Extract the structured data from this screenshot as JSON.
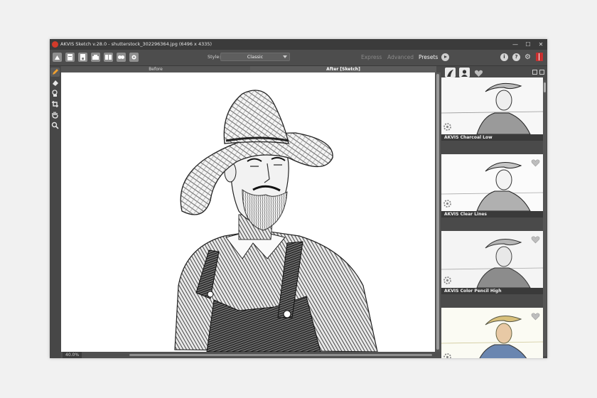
{
  "window": {
    "title": "AKVIS Sketch v.28.0 - shutterstock_302296364.jpg (6496 x 4335)",
    "controls": {
      "minimize": "—",
      "maximize": "☐",
      "close": "✕"
    }
  },
  "toolbar": {
    "buttons": [
      "home-icon",
      "open-file-icon",
      "save-file-icon",
      "print-icon",
      "batch-icon",
      "before-after-icon",
      "share-icon"
    ],
    "style_label": "Style:",
    "style_value": "Classic",
    "modes": {
      "express": "Express",
      "advanced": "Advanced",
      "presets": "Presets"
    },
    "active_mode": "Presets",
    "right_icons": {
      "info": "i",
      "help": "?",
      "settings": "⚙"
    }
  },
  "tools": [
    "pencil-icon",
    "eraser-icon",
    "stamp-icon",
    "crop-icon",
    "hand-icon",
    "zoom-icon"
  ],
  "view_tabs": {
    "before": "Before",
    "after": "After [Sketch]",
    "active": "after"
  },
  "status": {
    "zoom": "40.0%"
  },
  "presets_panel": {
    "tabs": [
      "all-presets-tab",
      "user-presets-tab",
      "favorites-tab"
    ],
    "items": [
      {
        "name": "AKVIS Charcoal Low",
        "tint": "gray"
      },
      {
        "name": "AKVIS Clear Lines",
        "tint": "gray"
      },
      {
        "name": "AKVIS Color Pencil High",
        "tint": "gray"
      },
      {
        "name": "",
        "tint": "color"
      }
    ]
  },
  "colors": {
    "accent_red": "#d13a2a",
    "panel_bg": "#4a4a4a",
    "title_bg": "#3b3b3b"
  }
}
